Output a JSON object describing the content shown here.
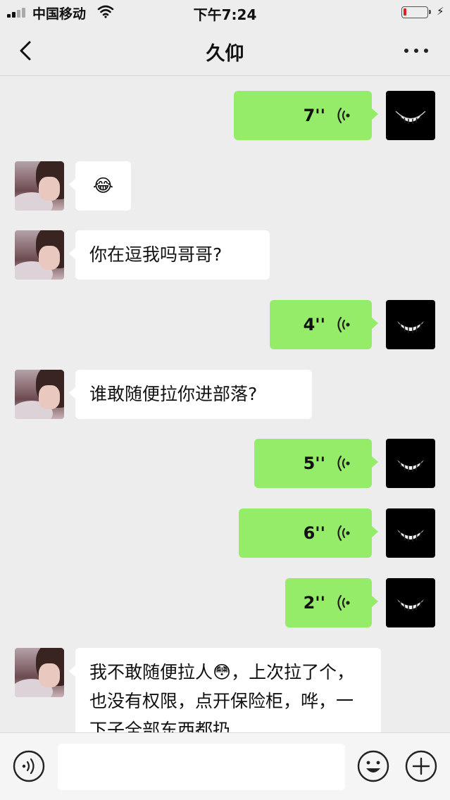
{
  "status_bar": {
    "carrier": "中国移动",
    "time": "下午7:24",
    "battery_level": 0.12,
    "battery_color": "#e02020"
  },
  "header": {
    "title": "久仰",
    "back_icon": "chevron-left-icon",
    "more_icon": "more-dots-icon"
  },
  "messages": [
    {
      "side": "right",
      "type": "voice",
      "duration": "7''"
    },
    {
      "side": "left",
      "type": "text",
      "text": "😂"
    },
    {
      "side": "left",
      "type": "text",
      "text": "你在逗我吗哥哥?"
    },
    {
      "side": "right",
      "type": "voice",
      "duration": "4''"
    },
    {
      "side": "left",
      "type": "text",
      "text": "谁敢随便拉你进部落?"
    },
    {
      "side": "right",
      "type": "voice",
      "duration": "5''"
    },
    {
      "side": "right",
      "type": "voice",
      "duration": "6''"
    },
    {
      "side": "right",
      "type": "voice",
      "duration": "2''"
    },
    {
      "side": "left",
      "type": "text",
      "text": "我不敢随便拉人😳，上次拉了个，也没有权限，点开保险柜，哗，一下子全部东西都扔"
    }
  ],
  "colors": {
    "background": "#ededed",
    "outgoing_bubble": "#95ec69",
    "incoming_bubble": "#ffffff"
  },
  "input_bar": {
    "voice_icon": "voice-input-icon",
    "emoji_icon": "emoji-icon",
    "plus_icon": "plus-icon",
    "placeholder": ""
  }
}
